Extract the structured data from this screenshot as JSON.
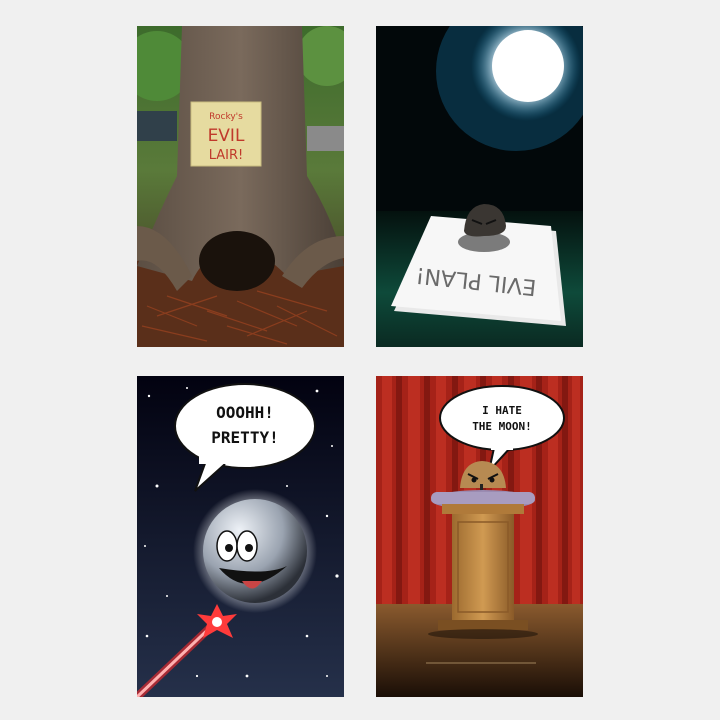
{
  "panels": [
    {
      "id": "tree-lair",
      "sign": {
        "line1": "Rocky's",
        "line2": "EVIL",
        "line3": "LAIR!"
      }
    },
    {
      "id": "evil-plan",
      "paper_text": "EVIL PLAN!"
    },
    {
      "id": "moon",
      "bubble": {
        "line1": "OOOHH!",
        "line2": "PRETTY!"
      }
    },
    {
      "id": "podium",
      "bubble": {
        "line1": "I HATE",
        "line2": "THE MOON!"
      }
    }
  ],
  "colors": {
    "background": "#f0f0f0",
    "curtain": "#b3261e",
    "podium": "#c89246",
    "laser": "#ff2a2a"
  }
}
